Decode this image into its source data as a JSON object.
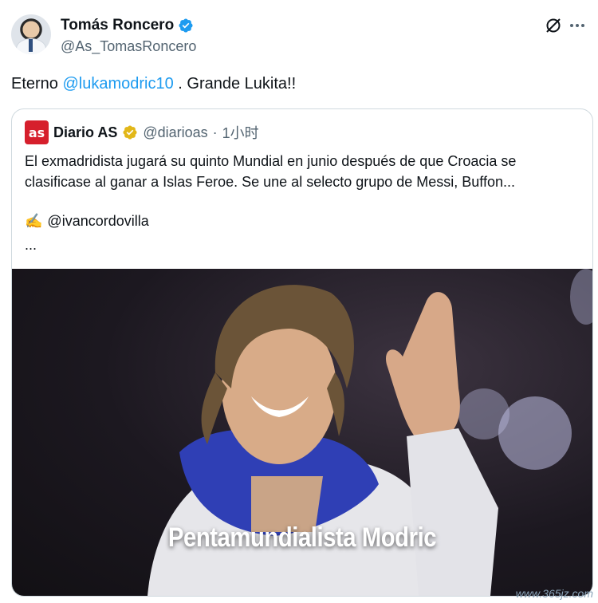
{
  "tweet": {
    "author": {
      "name": "Tomás Roncero",
      "handle": "@As_TomasRoncero"
    },
    "text_before": "Eterno ",
    "mention": "@lukamodric10",
    "text_after": " . Grande Lukita!!"
  },
  "quoted": {
    "logo_text": "as",
    "name": "Diario AS",
    "handle": "@diarioas",
    "separator": "·",
    "time": "1小时",
    "lines": [
      "El exmadridista jugará su quinto Mundial en junio después de que Croacia se",
      "clasificase al ganar a Islas Feroe. Se une al selecto grupo de Messi, Buffon..."
    ],
    "sign_emoji": "✍️",
    "sign_handle": "@ivancordovilla",
    "ellipsis": "...",
    "media_caption": "Pentamundialista Modric"
  },
  "watermark": "www.365jz.com",
  "colors": {
    "link": "#1d9bf0",
    "verified": "#1d9bf0",
    "org_verified": "#e2b719",
    "as_red": "#d61f2c"
  },
  "icons": [
    "verified-badge-icon",
    "grok-icon",
    "more-icon",
    "gold-verified-badge-icon",
    "writing-hand-icon"
  ]
}
